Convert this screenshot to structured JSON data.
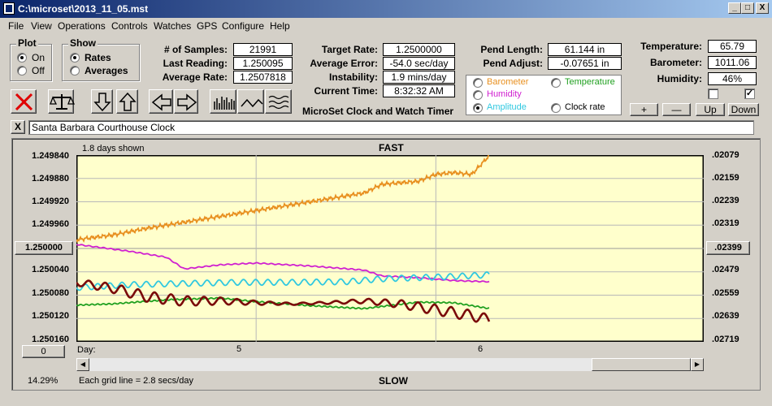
{
  "window": {
    "title": "C:\\microset\\2013_11_05.mst",
    "buttons": [
      "_",
      "□",
      "X"
    ]
  },
  "menu": [
    "File",
    "View",
    "Operations",
    "Controls",
    "Watches",
    "GPS",
    "Configure",
    "Help"
  ],
  "plot": {
    "title": "Plot",
    "options": [
      "On",
      "Off"
    ],
    "selected": "On"
  },
  "show": {
    "title": "Show",
    "options": [
      "Rates",
      "Averages"
    ],
    "selected": "Rates"
  },
  "stats": {
    "samples_label": "# of Samples:",
    "samples": "21991",
    "last_label": "Last Reading:",
    "last": "1.250095",
    "avg_label": "Average Rate:",
    "avg": "1.2507818",
    "target_label": "Target Rate:",
    "target": "1.2500000",
    "avgerr_label": "Average Error:",
    "avgerr": "-54.0 sec/day",
    "instab_label": "Instability:",
    "instab": "1.9 mins/day",
    "time_label": "Current Time:",
    "time": "8:32:32 AM",
    "pendlen_label": "Pend Length:",
    "pendlen": "61.144 in",
    "pendadj_label": "Pend Adjust:",
    "pendadj": "-0.07651 in",
    "temp_label": "Temperature:",
    "temp": "65.79",
    "baro_label": "Barometer:",
    "baro": "1011.06",
    "hum_label": "Humidity:",
    "hum": "46%"
  },
  "subtitle": "MicroSet Clock and Watch Timer",
  "legend": [
    {
      "label": "Barometer",
      "color": "#e89020",
      "selected": false
    },
    {
      "label": "Temperature",
      "color": "#20a020",
      "selected": false
    },
    {
      "label": "Humidity",
      "color": "#d020d0",
      "selected": false
    },
    {
      "label": "Clock rate",
      "color": "#000000",
      "selected": false
    },
    {
      "label": "Amplitude",
      "color": "#30c8e0",
      "selected": true
    }
  ],
  "adjust_buttons": [
    "+",
    "—",
    "Up",
    "Down"
  ],
  "toolbar_icons": [
    "close-x-icon",
    "balance-scale-icon",
    "arrow-down-icon",
    "arrow-up-icon",
    "arrow-left-icon",
    "arrow-right-icon",
    "bar-graph-icon",
    "line-graph-icon",
    "wave-graph-icon"
  ],
  "clock_name": "Santa Barbara Courthouse Clock",
  "clear_btn": "X",
  "chart": {
    "days_shown": "1.8 days shown",
    "top_label": "FAST",
    "bottom_label": "SLOW",
    "day_label": "Day:",
    "grid_note": "Each grid line = 2.8 secs/day",
    "percent": "14.29%",
    "left_ticks": [
      "1.249840",
      "1.249880",
      "1.249920",
      "1.249960",
      "1.250000",
      "1.250040",
      "1.250080",
      "1.250120",
      "1.250160"
    ],
    "right_ticks": [
      ".02079",
      ".02159",
      ".02239",
      ".02319",
      ".02399",
      ".02479",
      ".02559",
      ".02639",
      ".02719"
    ],
    "center_left_button": "1.250000",
    "center_right_button": ".02399",
    "zero_button": "0",
    "x_ticks": [
      "5",
      "6"
    ],
    "bg_color": "#ffffcc"
  },
  "chart_data": {
    "type": "line",
    "title": "",
    "xlabel": "Day:",
    "ylabel": "",
    "x_range": [
      4.0,
      6.55
    ],
    "ylim": [
      1.25016,
      1.24984
    ],
    "series": [
      {
        "name": "Barometer",
        "color": "#e89020",
        "x": [
          4.0,
          4.2,
          4.4,
          4.6,
          4.8,
          5.0,
          5.2,
          5.4,
          5.6,
          5.7,
          5.9,
          6.0,
          6.1,
          6.2,
          6.3
        ],
        "y": [
          1.249985,
          1.249977,
          1.249965,
          1.249955,
          1.249945,
          1.249935,
          1.249925,
          1.249915,
          1.249905,
          1.24989,
          1.249885,
          1.249873,
          1.24987,
          1.249873,
          1.24984
        ]
      },
      {
        "name": "Humidity",
        "color": "#d020d0",
        "x": [
          4.0,
          4.3,
          4.5,
          4.6,
          4.8,
          5.0,
          5.3,
          5.6,
          5.7,
          5.9,
          6.1,
          6.3
        ],
        "y": [
          1.249993,
          1.250005,
          1.250015,
          1.250035,
          1.250028,
          1.250025,
          1.25003,
          1.250037,
          1.250047,
          1.25005,
          1.250055,
          1.250057
        ]
      },
      {
        "name": "Amplitude",
        "color": "#30c8e0",
        "x": [
          4.0,
          4.3,
          4.6,
          4.9,
          5.2,
          5.5,
          5.7,
          5.9,
          6.1,
          6.3
        ],
        "y": [
          1.250067,
          1.250062,
          1.25006,
          1.250058,
          1.250058,
          1.250057,
          1.250052,
          1.25005,
          1.250048,
          1.250045
        ]
      },
      {
        "name": "Temperature",
        "color": "#20a020",
        "x": [
          4.0,
          4.2,
          4.5,
          4.8,
          5.0,
          5.3,
          5.6,
          5.9,
          6.1,
          6.3
        ],
        "y": [
          1.250097,
          1.250095,
          1.250088,
          1.250085,
          1.250091,
          1.250098,
          1.250103,
          1.250092,
          1.250093,
          1.250103
        ]
      },
      {
        "name": "Clock rate",
        "color": "#7a0a0a",
        "x": [
          4.0,
          4.2,
          4.4,
          4.6,
          4.8,
          5.0,
          5.2,
          5.4,
          5.6,
          5.8,
          6.0,
          6.2,
          6.3
        ],
        "y": [
          1.250058,
          1.250068,
          1.250083,
          1.25009,
          1.25009,
          1.250093,
          1.250095,
          1.250093,
          1.25009,
          1.250095,
          1.250105,
          1.250115,
          1.250122
        ]
      }
    ]
  }
}
